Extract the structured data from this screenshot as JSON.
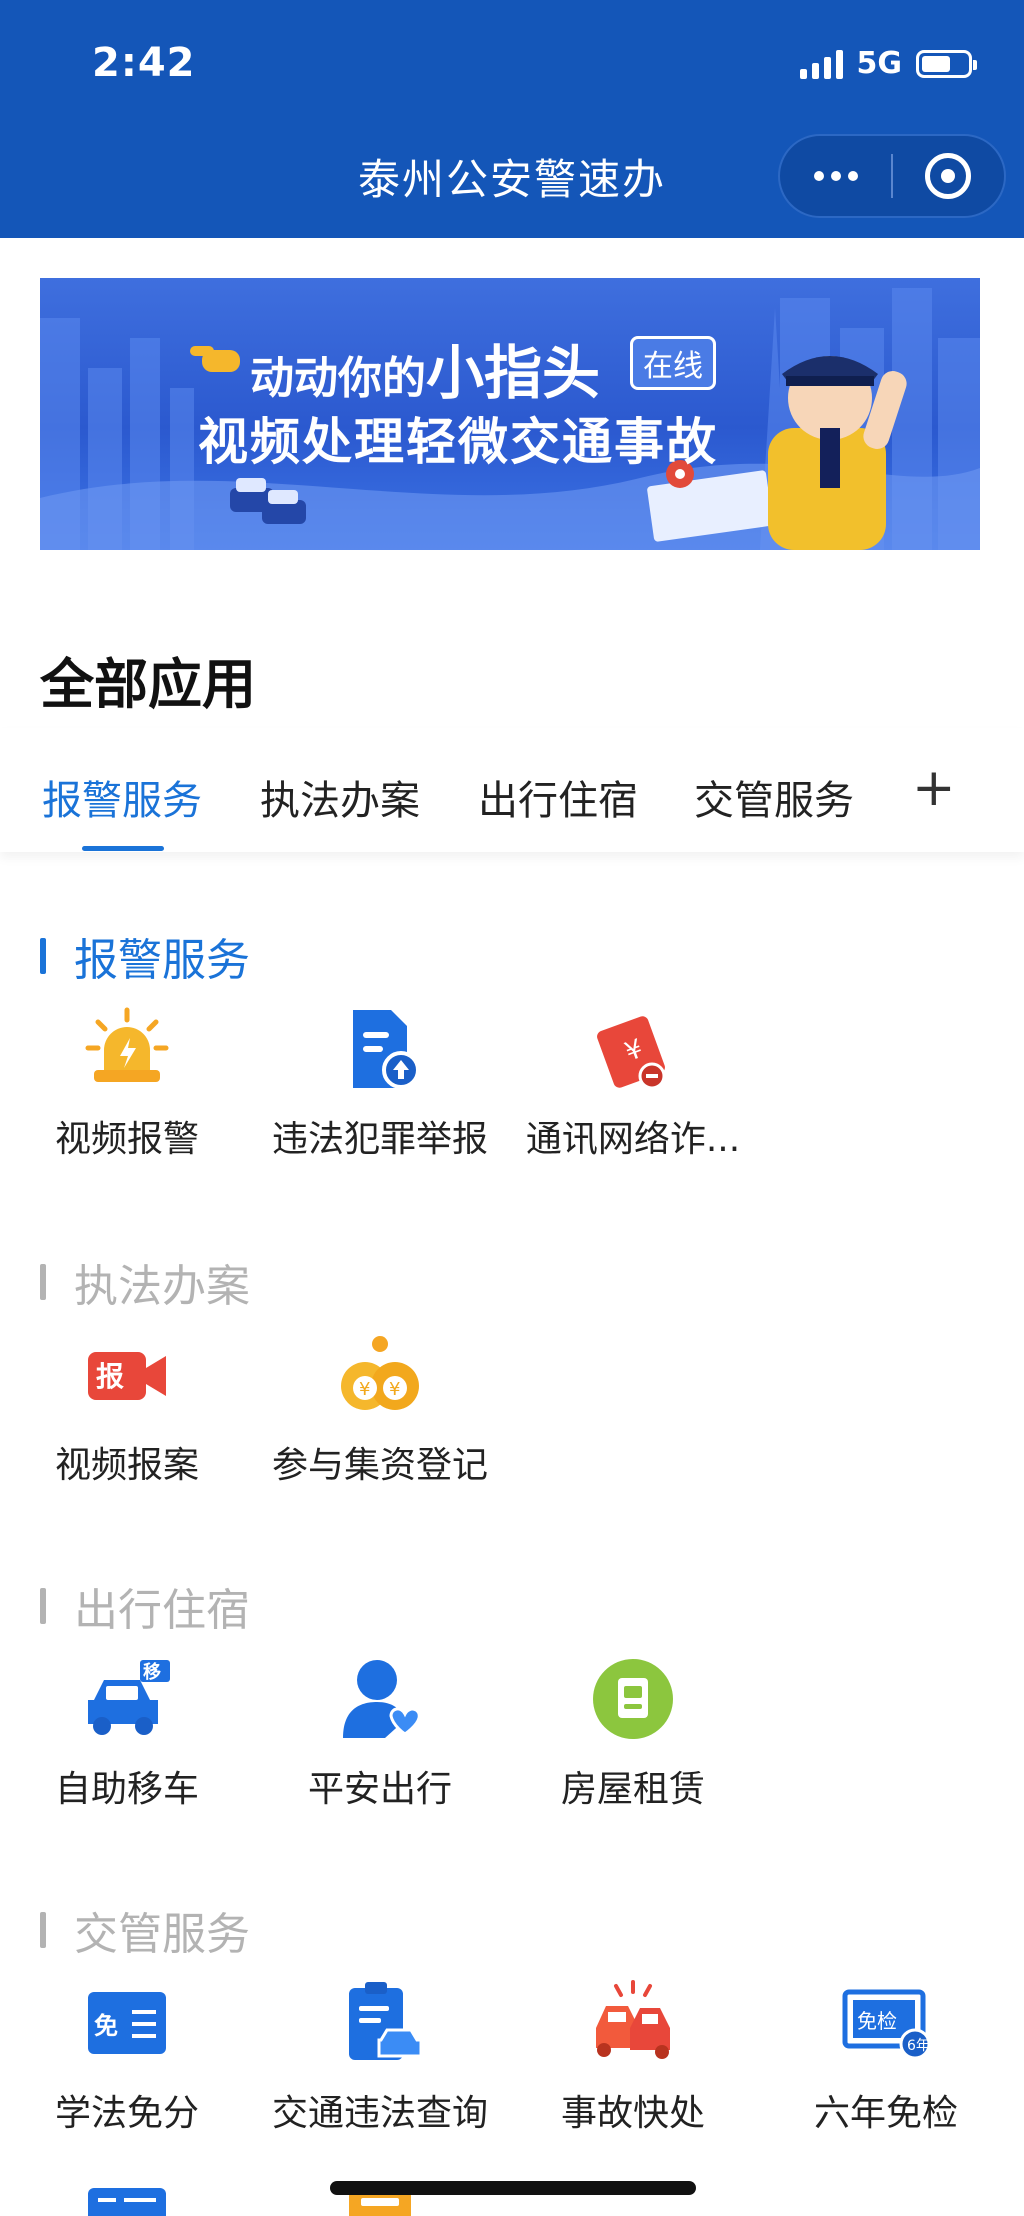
{
  "status_bar": {
    "time": "2:42",
    "network": "5G"
  },
  "nav": {
    "title": "泰州公安警速办"
  },
  "banner": {
    "line1_prefix": "动动你的",
    "line1_big": "小指头",
    "tag": "在线",
    "line2": "视频处理轻微交通事故"
  },
  "section_title": "全部应用",
  "tabs": [
    {
      "label": "报警服务"
    },
    {
      "label": "执法办案"
    },
    {
      "label": "出行住宿"
    },
    {
      "label": "交管服务"
    }
  ],
  "tab_more": "+",
  "groups": [
    {
      "title": "报警服务",
      "apps": [
        {
          "label": "视频报警",
          "icon": "alarm-light-icon"
        },
        {
          "label": "违法犯罪举报",
          "icon": "report-upload-icon"
        },
        {
          "label": "通讯网络诈...",
          "icon": "fraud-tag-icon"
        }
      ]
    },
    {
      "title": "执法办案",
      "apps": [
        {
          "label": "视频报案",
          "icon": "video-report-icon"
        },
        {
          "label": "参与集资登记",
          "icon": "money-bags-icon"
        }
      ]
    },
    {
      "title": "出行住宿",
      "apps": [
        {
          "label": "自助移车",
          "icon": "move-car-icon"
        },
        {
          "label": "平安出行",
          "icon": "safe-travel-icon"
        },
        {
          "label": "房屋租赁",
          "icon": "house-rental-icon"
        }
      ]
    },
    {
      "title": "交管服务",
      "apps": [
        {
          "label": "学法免分",
          "icon": "study-exempt-icon"
        },
        {
          "label": "交通违法查询",
          "icon": "violation-query-icon"
        },
        {
          "label": "事故快处",
          "icon": "accident-icon"
        },
        {
          "label": "六年免检",
          "icon": "six-year-exempt-icon"
        }
      ]
    }
  ],
  "colors": {
    "brand_blue": "#1456b8",
    "active_tab": "#1a73d8",
    "inactive_group_title": "#b3b3b3"
  }
}
